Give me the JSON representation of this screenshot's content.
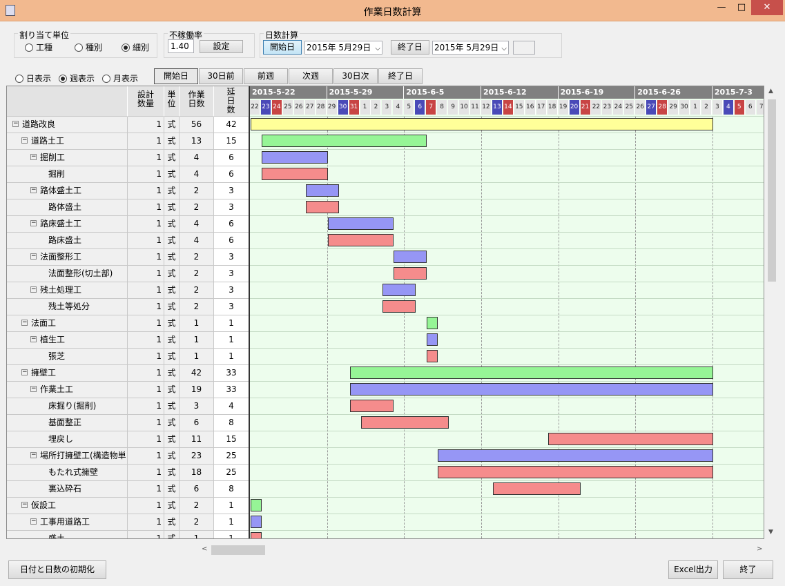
{
  "window": {
    "title": "作業日数計算",
    "min_glyph": "—",
    "max_glyph": "□",
    "close_glyph": "✕"
  },
  "allocation": {
    "label": "割り当て単位",
    "options": [
      {
        "label": "工種",
        "selected": false
      },
      {
        "label": "種別",
        "selected": false
      },
      {
        "label": "細別",
        "selected": true
      }
    ]
  },
  "downtime": {
    "label": "不稼働率",
    "value": "1.40",
    "set_label": "設定"
  },
  "daycalc": {
    "label": "日数計算",
    "start_button": "開始日",
    "start_date": "2015年 5月29日",
    "end_button": "終了日",
    "end_date": "2015年 5月29日",
    "result": ""
  },
  "view": {
    "options": [
      {
        "label": "日表示",
        "selected": false
      },
      {
        "label": "週表示",
        "selected": true
      },
      {
        "label": "月表示",
        "selected": false
      }
    ]
  },
  "nav": {
    "start": "開始日",
    "prev30": "30日前",
    "prev_week": "前週",
    "next_week": "次週",
    "next30": "30日次",
    "end": "終了日"
  },
  "grid": {
    "headers": {
      "qty": "設計\n数量",
      "unit": "単\n位",
      "days": "作業\n日数",
      "ext": "延\n日\n数"
    },
    "rows": [
      {
        "name": "道路改良",
        "level": 0,
        "toggle": "⊟",
        "qty": "1",
        "unit": "式",
        "days": "56",
        "ext": "42",
        "color": "#ffff99",
        "bar_start": 0,
        "bar_len": 42
      },
      {
        "name": "道路土工",
        "level": 1,
        "toggle": "⊟",
        "qty": "1",
        "unit": "式",
        "days": "13",
        "ext": "15",
        "color": "#96f596",
        "bar_start": 1,
        "bar_len": 15
      },
      {
        "name": "掘削工",
        "level": 2,
        "toggle": "⊟",
        "qty": "1",
        "unit": "式",
        "days": "4",
        "ext": "6",
        "color": "#9696f5",
        "bar_start": 1,
        "bar_len": 6
      },
      {
        "name": "掘削",
        "level": 3,
        "toggle": "",
        "qty": "1",
        "unit": "式",
        "days": "4",
        "ext": "6",
        "color": "#f58c8c",
        "bar_start": 1,
        "bar_len": 6
      },
      {
        "name": "路体盛土工",
        "level": 2,
        "toggle": "⊟",
        "qty": "1",
        "unit": "式",
        "days": "2",
        "ext": "3",
        "color": "#9696f5",
        "bar_start": 5,
        "bar_len": 3
      },
      {
        "name": "路体盛土",
        "level": 3,
        "toggle": "",
        "qty": "1",
        "unit": "式",
        "days": "2",
        "ext": "3",
        "color": "#f58c8c",
        "bar_start": 5,
        "bar_len": 3
      },
      {
        "name": "路床盛土工",
        "level": 2,
        "toggle": "⊟",
        "qty": "1",
        "unit": "式",
        "days": "4",
        "ext": "6",
        "color": "#9696f5",
        "bar_start": 7,
        "bar_len": 6
      },
      {
        "name": "路床盛土",
        "level": 3,
        "toggle": "",
        "qty": "1",
        "unit": "式",
        "days": "4",
        "ext": "6",
        "color": "#f58c8c",
        "bar_start": 7,
        "bar_len": 6
      },
      {
        "name": "法面整形工",
        "level": 2,
        "toggle": "⊟",
        "qty": "1",
        "unit": "式",
        "days": "2",
        "ext": "3",
        "color": "#9696f5",
        "bar_start": 13,
        "bar_len": 3
      },
      {
        "name": "法面整形(切土部)",
        "level": 3,
        "toggle": "",
        "qty": "1",
        "unit": "式",
        "days": "2",
        "ext": "3",
        "color": "#f58c8c",
        "bar_start": 13,
        "bar_len": 3
      },
      {
        "name": "残土処理工",
        "level": 2,
        "toggle": "⊟",
        "qty": "1",
        "unit": "式",
        "days": "2",
        "ext": "3",
        "color": "#9696f5",
        "bar_start": 12,
        "bar_len": 3
      },
      {
        "name": "残土等処分",
        "level": 3,
        "toggle": "",
        "qty": "1",
        "unit": "式",
        "days": "2",
        "ext": "3",
        "color": "#f58c8c",
        "bar_start": 12,
        "bar_len": 3
      },
      {
        "name": "法面工",
        "level": 1,
        "toggle": "⊟",
        "qty": "1",
        "unit": "式",
        "days": "1",
        "ext": "1",
        "color": "#96f596",
        "bar_start": 16,
        "bar_len": 1
      },
      {
        "name": "植生工",
        "level": 2,
        "toggle": "⊟",
        "qty": "1",
        "unit": "式",
        "days": "1",
        "ext": "1",
        "color": "#9696f5",
        "bar_start": 16,
        "bar_len": 1
      },
      {
        "name": "張芝",
        "level": 3,
        "toggle": "",
        "qty": "1",
        "unit": "式",
        "days": "1",
        "ext": "1",
        "color": "#f58c8c",
        "bar_start": 16,
        "bar_len": 1
      },
      {
        "name": "擁壁工",
        "level": 1,
        "toggle": "⊟",
        "qty": "1",
        "unit": "式",
        "days": "42",
        "ext": "33",
        "color": "#96f596",
        "bar_start": 9,
        "bar_len": 33
      },
      {
        "name": "作業土工",
        "level": 2,
        "toggle": "⊟",
        "qty": "1",
        "unit": "式",
        "days": "19",
        "ext": "33",
        "color": "#9696f5",
        "bar_start": 9,
        "bar_len": 33
      },
      {
        "name": "床掘り(掘削)",
        "level": 3,
        "toggle": "",
        "qty": "1",
        "unit": "式",
        "days": "3",
        "ext": "4",
        "color": "#f58c8c",
        "bar_start": 9,
        "bar_len": 4
      },
      {
        "name": "基面整正",
        "level": 3,
        "toggle": "",
        "qty": "1",
        "unit": "式",
        "days": "6",
        "ext": "8",
        "color": "#f58c8c",
        "bar_start": 10,
        "bar_len": 8
      },
      {
        "name": "埋戻し",
        "level": 3,
        "toggle": "",
        "qty": "1",
        "unit": "式",
        "days": "11",
        "ext": "15",
        "color": "#f58c8c",
        "bar_start": 27,
        "bar_len": 15
      },
      {
        "name": "場所打擁壁工(構造物単",
        "level": 2,
        "toggle": "⊟",
        "qty": "1",
        "unit": "式",
        "days": "23",
        "ext": "25",
        "color": "#9696f5",
        "bar_start": 17,
        "bar_len": 25
      },
      {
        "name": "もたれ式擁壁",
        "level": 3,
        "toggle": "",
        "qty": "1",
        "unit": "式",
        "days": "18",
        "ext": "25",
        "color": "#f58c8c",
        "bar_start": 17,
        "bar_len": 25
      },
      {
        "name": "裏込砕石",
        "level": 3,
        "toggle": "",
        "qty": "1",
        "unit": "式",
        "days": "6",
        "ext": "8",
        "color": "#f58c8c",
        "bar_start": 22,
        "bar_len": 8
      },
      {
        "name": "仮設工",
        "level": 1,
        "toggle": "⊟",
        "qty": "1",
        "unit": "式",
        "days": "2",
        "ext": "1",
        "color": "#96f596",
        "bar_start": 0,
        "bar_len": 1
      },
      {
        "name": "工事用道路工",
        "level": 2,
        "toggle": "⊟",
        "qty": "1",
        "unit": "式",
        "days": "2",
        "ext": "1",
        "color": "#9696f5",
        "bar_start": 0,
        "bar_len": 1
      },
      {
        "name": "盛土",
        "level": 3,
        "toggle": "",
        "qty": "1",
        "unit": "式",
        "days": "1",
        "ext": "1",
        "color": "#f58c8c",
        "bar_start": 0,
        "bar_len": 1
      }
    ]
  },
  "timeline": {
    "weeks": [
      "2015-5-22",
      "2015-5-29",
      "2015-6-5",
      "2015-6-12",
      "2015-6-19",
      "2015-6-26",
      "2015-7-3"
    ],
    "days": [
      {
        "d": "22",
        "k": ""
      },
      {
        "d": "23",
        "k": "sat"
      },
      {
        "d": "24",
        "k": "sun"
      },
      {
        "d": "25",
        "k": ""
      },
      {
        "d": "26",
        "k": ""
      },
      {
        "d": "27",
        "k": ""
      },
      {
        "d": "28",
        "k": ""
      },
      {
        "d": "29",
        "k": ""
      },
      {
        "d": "30",
        "k": "sat"
      },
      {
        "d": "31",
        "k": "sun"
      },
      {
        "d": "1",
        "k": ""
      },
      {
        "d": "2",
        "k": ""
      },
      {
        "d": "3",
        "k": ""
      },
      {
        "d": "4",
        "k": ""
      },
      {
        "d": "5",
        "k": ""
      },
      {
        "d": "6",
        "k": "sat"
      },
      {
        "d": "7",
        "k": "sun"
      },
      {
        "d": "8",
        "k": ""
      },
      {
        "d": "9",
        "k": ""
      },
      {
        "d": "10",
        "k": ""
      },
      {
        "d": "11",
        "k": ""
      },
      {
        "d": "12",
        "k": ""
      },
      {
        "d": "13",
        "k": "sat"
      },
      {
        "d": "14",
        "k": "sun"
      },
      {
        "d": "15",
        "k": ""
      },
      {
        "d": "16",
        "k": ""
      },
      {
        "d": "17",
        "k": ""
      },
      {
        "d": "18",
        "k": ""
      },
      {
        "d": "19",
        "k": ""
      },
      {
        "d": "20",
        "k": "sat"
      },
      {
        "d": "21",
        "k": "sun"
      },
      {
        "d": "22",
        "k": ""
      },
      {
        "d": "23",
        "k": ""
      },
      {
        "d": "24",
        "k": ""
      },
      {
        "d": "25",
        "k": ""
      },
      {
        "d": "26",
        "k": ""
      },
      {
        "d": "27",
        "k": "sat"
      },
      {
        "d": "28",
        "k": "sun"
      },
      {
        "d": "29",
        "k": ""
      },
      {
        "d": "30",
        "k": ""
      },
      {
        "d": "1",
        "k": ""
      },
      {
        "d": "2",
        "k": ""
      },
      {
        "d": "3",
        "k": ""
      },
      {
        "d": "4",
        "k": "sat"
      },
      {
        "d": "5",
        "k": "sun"
      },
      {
        "d": "6",
        "k": ""
      },
      {
        "d": "7",
        "k": ""
      }
    ]
  },
  "scroll": {
    "up": "▲",
    "down": "▼",
    "left": "<",
    "right": ">"
  },
  "footer": {
    "reset": "日付と日数の初期化",
    "excel": "Excel出力",
    "exit": "終了"
  }
}
